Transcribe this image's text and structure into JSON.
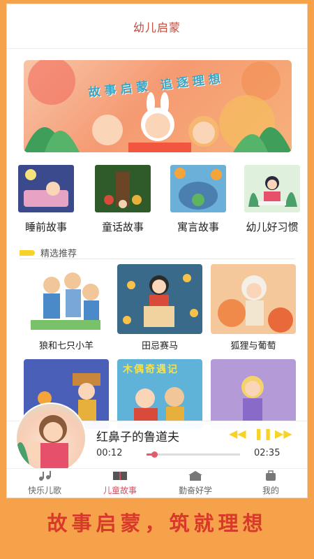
{
  "header": {
    "title": "幼儿启蒙"
  },
  "banner": {
    "text": "故事启蒙 追逐理想"
  },
  "categories": [
    {
      "label": "睡前故事",
      "icon": "moon-bed-icon"
    },
    {
      "label": "童话故事",
      "icon": "forest-tree-icon"
    },
    {
      "label": "寓言故事",
      "icon": "frog-well-icon"
    },
    {
      "label": "幼儿好习惯",
      "icon": "reading-girl-icon"
    }
  ],
  "section": {
    "title": "精选推荐"
  },
  "stories": [
    {
      "title": "狼和七只小羊"
    },
    {
      "title": "田忌赛马"
    },
    {
      "title": "狐狸与葡萄"
    },
    {
      "title": ""
    },
    {
      "title": ""
    },
    {
      "title": ""
    }
  ],
  "story_badge": "木偶奇遇记",
  "player": {
    "track": "红鼻子的鲁道夫",
    "elapsed": "00:12",
    "duration": "02:35",
    "progress": 0.08
  },
  "tabs": [
    {
      "label": "快乐儿歌",
      "active": false
    },
    {
      "label": "儿童故事",
      "active": true
    },
    {
      "label": "勤奋好学",
      "active": false
    },
    {
      "label": "我的",
      "active": false
    }
  ],
  "slogan": "故事启蒙，筑就理想",
  "colors": {
    "accent": "#d94c5c",
    "brand": "#c24a3a",
    "background": "#f6a24b",
    "highlight": "#f7d32a"
  }
}
